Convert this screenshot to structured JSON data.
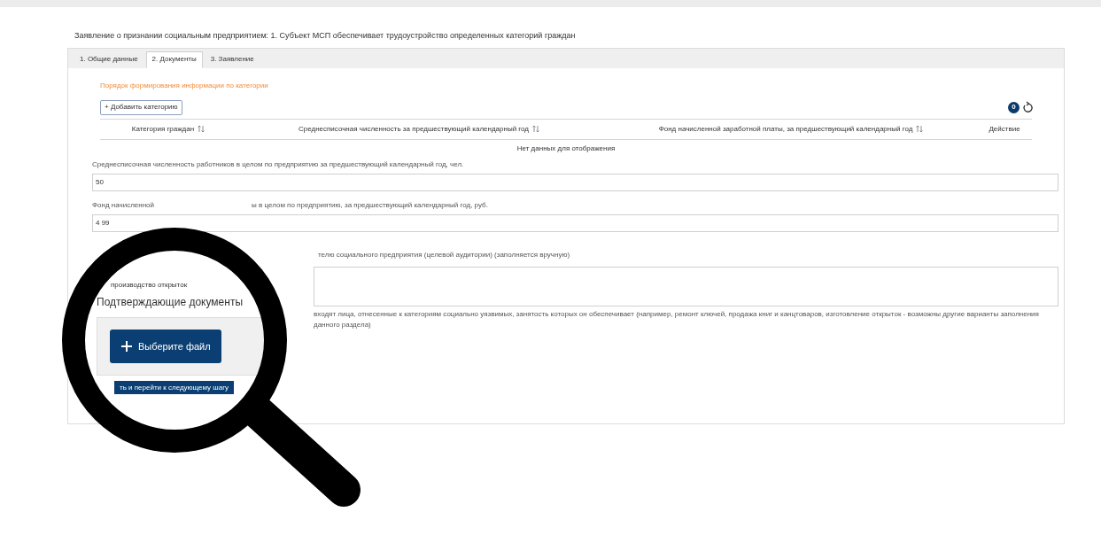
{
  "title": "Заявление о признании социальным предприятием: 1. Субъект МСП обеспечивает трудоустройство определенных категорий граждан",
  "tabs": [
    {
      "label": "1. Общие данные",
      "selected": false
    },
    {
      "label": "2. Документы",
      "selected": true
    },
    {
      "label": "3. Заявление",
      "selected": false
    }
  ],
  "info_link": "Порядок формирования информации по категории",
  "add_button": "+ Добавить категорию",
  "count_badge": "0",
  "table": {
    "columns": [
      {
        "label": "Категория граждан",
        "sortable": true
      },
      {
        "label": "Среднесписочная численность за предшествующий календарный год",
        "sortable": true
      },
      {
        "label": "Фонд начисленной заработной платы, за предшествующий календарный год",
        "sortable": true
      },
      {
        "label": "Действие",
        "sortable": false
      }
    ],
    "empty": "Нет данных для отображения"
  },
  "fields": [
    {
      "label": "Среднесписочная численность работников в целом по предприятию за предшествующий календарный год, чел.",
      "value": "50"
    },
    {
      "label_start": "Фонд начисленной",
      "label_end": "ы в целом по предприятию, за предшествующий календарный год, руб.",
      "value": "4 99"
    }
  ],
  "goods_label": "телю социального предприятия (целевой аудитории) (заполняется вручную)",
  "goods_hint": "входят лица, отнесенные к категориям социально уязвимых, занятость которых он обеспечивает (например, ремонт ключей, продажа книг и канцтоваров, изготовление открыток - возможны другие варианты заполнения данного раздела)",
  "lens": {
    "value": "производство открыток",
    "heading": "Подтверждающие документы",
    "file_button": "Выберите файл",
    "next_button": "ть и перейти к следующему шагу"
  }
}
